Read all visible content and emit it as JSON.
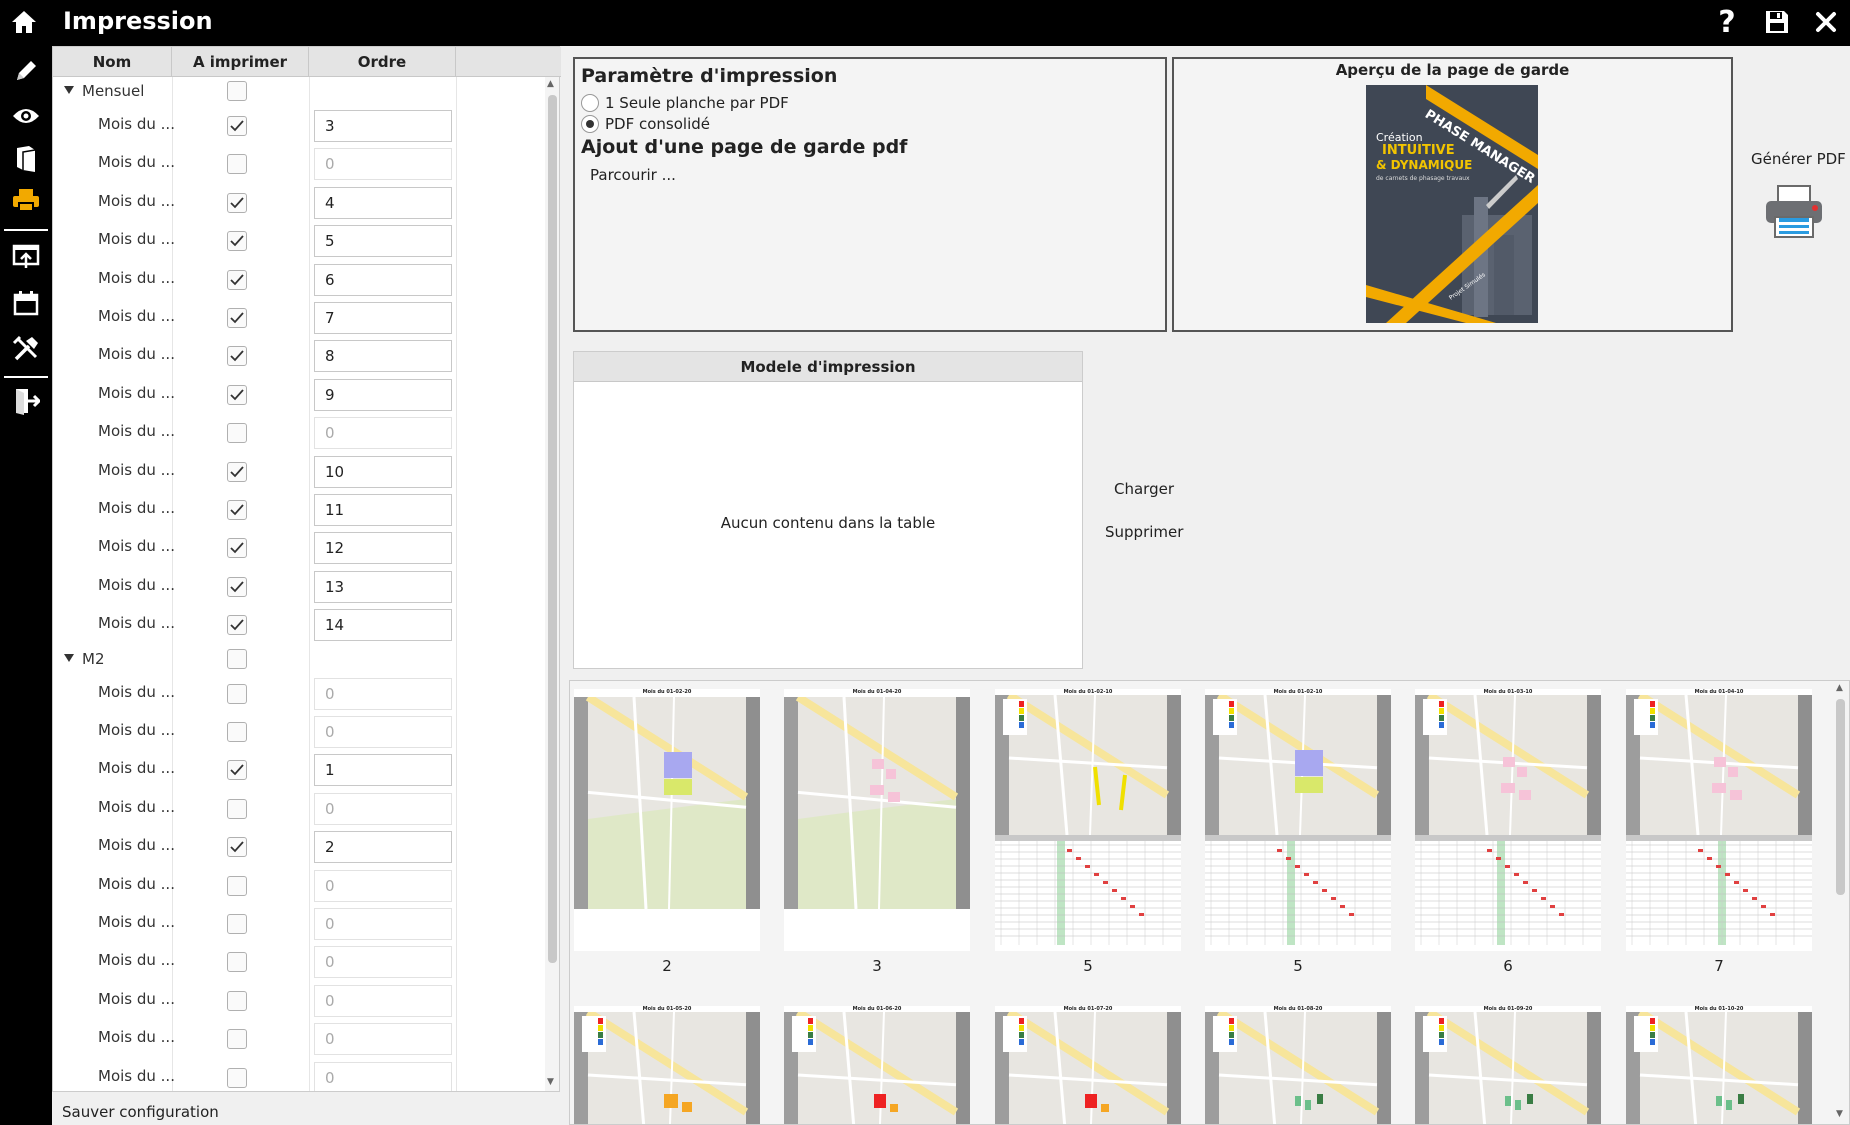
{
  "window": {
    "title": "Impression",
    "icons": [
      "home-icon",
      "help-icon",
      "save-icon",
      "close-icon"
    ]
  },
  "nav": {
    "items": [
      "pencil-icon",
      "eye-icon",
      "book-icon",
      "printer-icon",
      "export-icon",
      "calendar-icon",
      "tools-icon",
      "exit-icon"
    ],
    "active": "printer-icon",
    "accent": "#f2a900"
  },
  "list": {
    "columns": [
      "Nom",
      "A imprimer",
      "Ordre"
    ],
    "groups": [
      {
        "name": "Mensuel",
        "rows": [
          {
            "name": "Mois du ...",
            "checked": true,
            "ordre": "3"
          },
          {
            "name": "Mois du ...",
            "checked": false,
            "ordre": "0"
          },
          {
            "name": "Mois du ...",
            "checked": true,
            "ordre": "4"
          },
          {
            "name": "Mois du ...",
            "checked": true,
            "ordre": "5"
          },
          {
            "name": "Mois du ...",
            "checked": true,
            "ordre": "6"
          },
          {
            "name": "Mois du ...",
            "checked": true,
            "ordre": "7"
          },
          {
            "name": "Mois du ...",
            "checked": true,
            "ordre": "8"
          },
          {
            "name": "Mois du ...",
            "checked": true,
            "ordre": "9"
          },
          {
            "name": "Mois du ...",
            "checked": false,
            "ordre": "0"
          },
          {
            "name": "Mois du ...",
            "checked": true,
            "ordre": "10"
          },
          {
            "name": "Mois du ...",
            "checked": true,
            "ordre": "11"
          },
          {
            "name": "Mois du ...",
            "checked": true,
            "ordre": "12"
          },
          {
            "name": "Mois du ...",
            "checked": true,
            "ordre": "13"
          },
          {
            "name": "Mois du ...",
            "checked": true,
            "ordre": "14"
          }
        ]
      },
      {
        "name": "M2",
        "rows": [
          {
            "name": "Mois du ...",
            "checked": false,
            "ordre": "0"
          },
          {
            "name": "Mois du ...",
            "checked": false,
            "ordre": "0"
          },
          {
            "name": "Mois du ...",
            "checked": true,
            "ordre": "1"
          },
          {
            "name": "Mois du ...",
            "checked": false,
            "ordre": "0"
          },
          {
            "name": "Mois du ...",
            "checked": true,
            "ordre": "2"
          },
          {
            "name": "Mois du ...",
            "checked": false,
            "ordre": "0"
          },
          {
            "name": "Mois du ...",
            "checked": false,
            "ordre": "0"
          },
          {
            "name": "Mois du ...",
            "checked": false,
            "ordre": "0"
          },
          {
            "name": "Mois du ...",
            "checked": false,
            "ordre": "0"
          },
          {
            "name": "Mois du ...",
            "checked": false,
            "ordre": "0"
          },
          {
            "name": "Mois du ...",
            "checked": false,
            "ordre": "0"
          }
        ]
      }
    ],
    "save_config": "Sauver configuration"
  },
  "params": {
    "title": "Paramètre d'impression",
    "options": [
      "1 Seule planche par PDF",
      "PDF consolidé"
    ],
    "selected": 1,
    "cover_title": "Ajout d'une page de garde pdf",
    "browse": "Parcourir ..."
  },
  "preview": {
    "title": "Aperçu de la page de garde",
    "cover": {
      "brand": "PHASE MANAGER",
      "line1": "Création",
      "line2": "INTUITIVE",
      "line3": "& DYNAMIQUE",
      "line4": "de carnets de phasage travaux",
      "footer": "Projet Simulés"
    }
  },
  "generate_pdf": "Générer PDF",
  "modele": {
    "title": "Modele d'impression",
    "empty": "Aucun contenu dans la table",
    "load": "Charger",
    "delete": "Supprimer"
  },
  "thumbnails": {
    "row1": [
      {
        "label": "2",
        "title": "Mois du 01-02-20"
      },
      {
        "label": "3",
        "title": "Mois du 01-04-20"
      },
      {
        "label": "5",
        "title": "Mois du 01-02-10"
      },
      {
        "label": "5",
        "title": "Mois du 01-02-10"
      },
      {
        "label": "6",
        "title": "Mois du 01-03-10"
      },
      {
        "label": "7",
        "title": "Mois du 01-04-10"
      }
    ],
    "row2": [
      {
        "title": "Mois du 01-05-20"
      },
      {
        "title": "Mois du 01-06-20"
      },
      {
        "title": "Mois du 01-07-20"
      },
      {
        "title": "Mois du 01-08-20"
      },
      {
        "title": "Mois du 01-09-20"
      },
      {
        "title": "Mois du 01-10-20"
      }
    ]
  }
}
